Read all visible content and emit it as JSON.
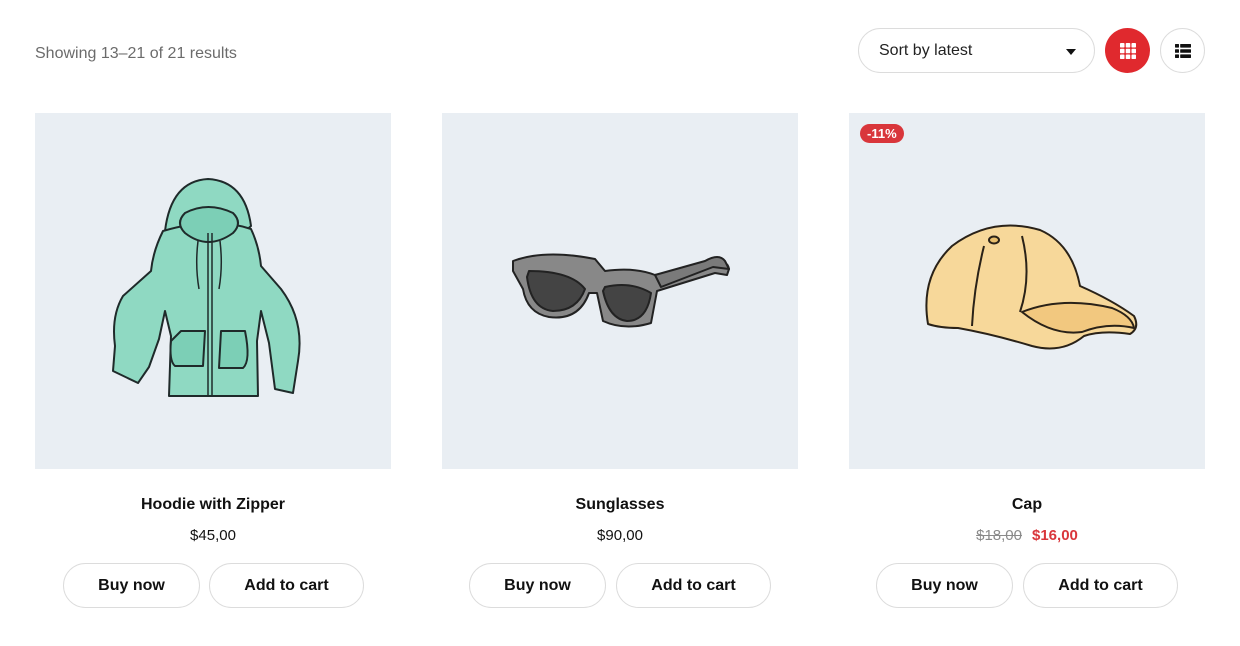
{
  "toolbar": {
    "result_count": "Showing 13–21 of 21 results",
    "sort_selected": "Sort by latest",
    "view_grid_icon": "grid-icon",
    "view_list_icon": "list-icon",
    "accent_color": "#e0292e"
  },
  "products": [
    {
      "name": "Hoodie with Zipper",
      "price": "$45,00",
      "image": "hoodie",
      "buy_label": "Buy now",
      "cart_label": "Add to cart"
    },
    {
      "name": "Sunglasses",
      "price": "$90,00",
      "image": "sunglasses",
      "buy_label": "Buy now",
      "cart_label": "Add to cart"
    },
    {
      "name": "Cap",
      "badge": "-11%",
      "old_price": "$18,00",
      "price": "$16,00",
      "image": "cap",
      "buy_label": "Buy now",
      "cart_label": "Add to cart"
    }
  ]
}
